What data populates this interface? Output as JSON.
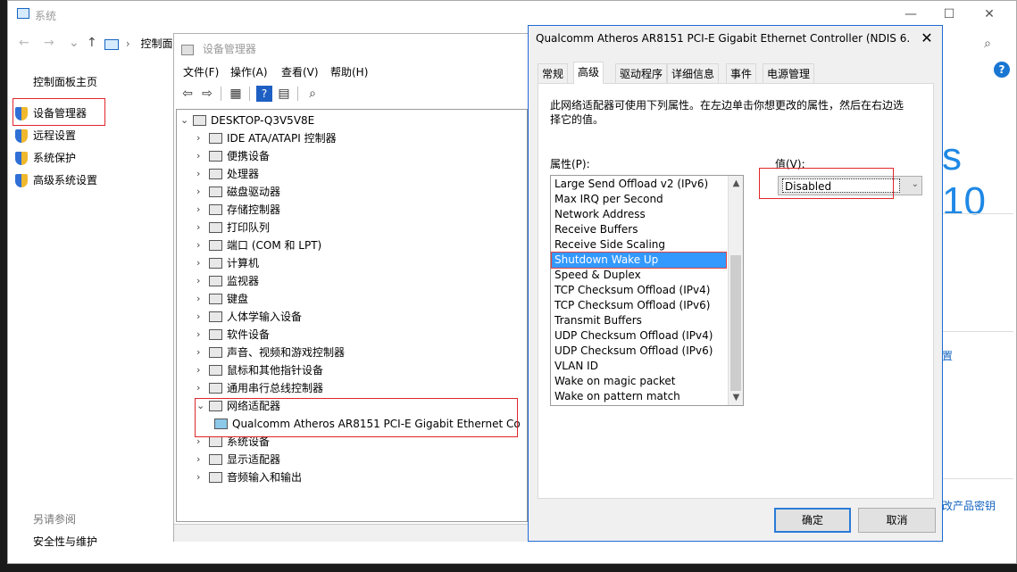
{
  "system": {
    "title": "系统",
    "breadcrumb": "控制面",
    "home_link": "控制面板主页",
    "links": [
      "设备管理器",
      "远程设置",
      "系统保护",
      "高级系统设置"
    ],
    "see_also": "另请参阅",
    "security_link": "安全性与维护",
    "right_big": "s 10",
    "right_link1": "置",
    "right_link2": "改产品密钥",
    "controls": {
      "minimize": "—",
      "maximize": "☐",
      "close": "✕"
    }
  },
  "device_manager": {
    "title": "设备管理器",
    "menu": [
      "文件(F)",
      "操作(A)",
      "查看(V)",
      "帮助(H)"
    ],
    "root": "DESKTOP-Q3V5V8E",
    "categories": [
      "IDE ATA/ATAPI 控制器",
      "便携设备",
      "处理器",
      "磁盘驱动器",
      "存储控制器",
      "打印队列",
      "端口 (COM 和 LPT)",
      "计算机",
      "监视器",
      "键盘",
      "人体学输入设备",
      "软件设备",
      "声音、视频和游戏控制器",
      "鼠标和其他指针设备",
      "通用串行总线控制器",
      "网络适配器",
      "Qualcomm Atheros AR8151 PCI-E Gigabit Ethernet Co",
      "系统设备",
      "显示适配器",
      "音频输入和输出"
    ]
  },
  "dialog": {
    "title": "Qualcomm Atheros AR8151 PCI-E Gigabit Ethernet Controller (NDIS 6....",
    "close": "✕",
    "tabs": [
      "常规",
      "高级",
      "驱动程序",
      "详细信息",
      "事件",
      "电源管理"
    ],
    "active_tab": "高级",
    "description": "此网络适配器可使用下列属性。在左边单击你想更改的属性，然后在右边选择它的值。",
    "property_label": "属性(P):",
    "value_label": "值(V):",
    "properties": [
      "Large Send Offload v2 (IPv6)",
      "Max IRQ per Second",
      "Network Address",
      "Receive Buffers",
      "Receive Side Scaling",
      "Shutdown Wake Up",
      "Speed & Duplex",
      "TCP Checksum Offload (IPv4)",
      "TCP Checksum Offload (IPv6)",
      "Transmit Buffers",
      "UDP Checksum Offload (IPv4)",
      "UDP Checksum Offload (IPv6)",
      "VLAN ID",
      "Wake on magic packet",
      "Wake on pattern match"
    ],
    "selected_property": "Shutdown Wake Up",
    "value": "Disabled",
    "ok": "确定",
    "cancel": "取消"
  },
  "colors": {
    "accent": "#1e88e5",
    "selection": "#3399ff",
    "highlight_box": "#e0262a"
  }
}
